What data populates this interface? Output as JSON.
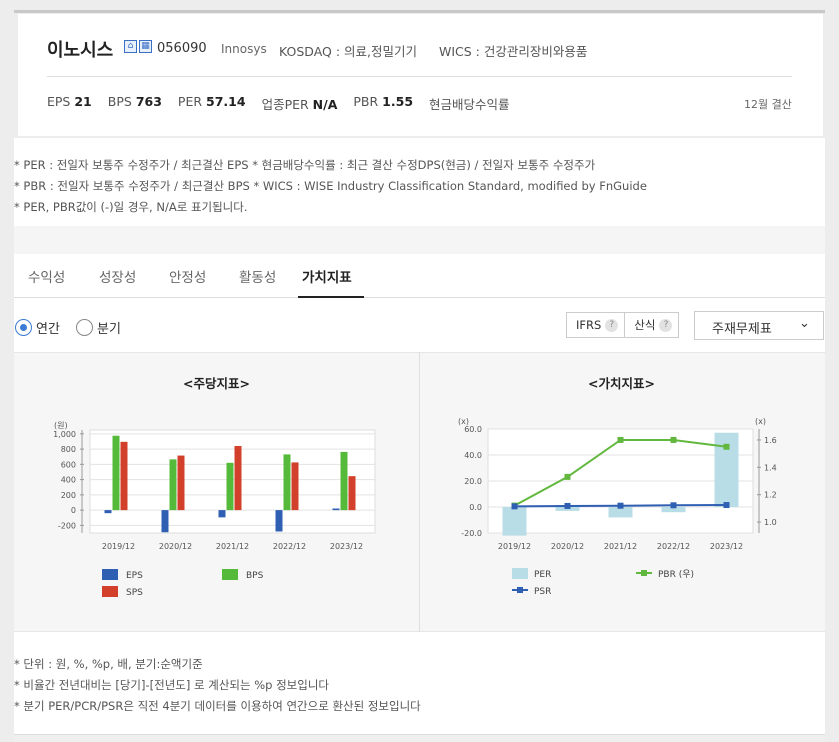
{
  "company": {
    "name": "이노시스",
    "code": "056090",
    "english_name": "Innosys",
    "market": "KOSDAQ : 의료,정밀기기",
    "wics": "WICS : 건강관리장비와용품",
    "settlement": "12월 결산"
  },
  "metrics": [
    {
      "label": "EPS",
      "value": "21"
    },
    {
      "label": "BPS",
      "value": "763"
    },
    {
      "label": "PER",
      "value": "57.14"
    },
    {
      "label": "업종PER",
      "value": "N/A"
    },
    {
      "label": "PBR",
      "value": "1.55"
    },
    {
      "label": "현금배당수익률",
      "value": ""
    }
  ],
  "notes": [
    "* PER : 전일자 보통주 수정주가 / 최근결산 EPS * 현금배당수익률 : 최근 결산 수정DPS(현금) / 전일자 보통주 수정주가",
    "* PBR : 전일자 보통주 수정주가 / 최근결산 BPS * WICS : WISE Industry Classification Standard, modified by FnGuide",
    "* PER, PBR값이 (-)일 경우, N/A로 표기됩니다."
  ],
  "tabs": [
    "수익성",
    "성장성",
    "안정성",
    "활동성",
    "가치지표"
  ],
  "active_tab": "가치지표",
  "period": {
    "annual": "연간",
    "quarter": "분기",
    "selected": "연간"
  },
  "buttons": {
    "ifrs": "IFRS",
    "calc": "산식"
  },
  "select": {
    "value": "주재무제표"
  },
  "charts": {
    "per_share_title": "<주당지표>",
    "valuation_title": "<가치지표>"
  },
  "colors": {
    "eps": "#2f5fb3",
    "bps": "#55b93a",
    "sps": "#d2402b",
    "per": "#b9dde7",
    "pbr": "#62b83e",
    "psr": "#2f5fb3",
    "accent": "#3a7bd5"
  },
  "chart_data": [
    {
      "type": "bar",
      "title": "<주당지표>",
      "ylabel": "(원)",
      "ylim": [
        -300,
        1050
      ],
      "yticks": [
        "1,000",
        "800",
        "600",
        "400",
        "200",
        "0",
        "-200"
      ],
      "categories": [
        "2019/12",
        "2020/12",
        "2021/12",
        "2022/12",
        "2023/12"
      ],
      "series": [
        {
          "name": "EPS",
          "values": [
            -40,
            -290,
            -95,
            -280,
            21
          ]
        },
        {
          "name": "BPS",
          "values": [
            975,
            665,
            620,
            730,
            763
          ]
        },
        {
          "name": "SPS",
          "values": [
            895,
            715,
            840,
            625,
            445
          ]
        }
      ],
      "legend": "bottom",
      "grid": true
    },
    {
      "type": "bar+line",
      "title": "<가치지표>",
      "ylabel_left": "(x)",
      "ylabel_right": "(x)",
      "ylim_left": [
        -20,
        60
      ],
      "ylim_right": [
        0.92,
        1.68
      ],
      "yticks_left": [
        "60.0",
        "40.0",
        "20.0",
        "0.0",
        "-20.0"
      ],
      "yticks_right": [
        "1.6",
        "1.4",
        "1.2",
        "1.0"
      ],
      "categories": [
        "2019/12",
        "2020/12",
        "2021/12",
        "2022/12",
        "2023/12"
      ],
      "series": [
        {
          "name": "PER",
          "axis": "left",
          "kind": "bar",
          "values": [
            -22,
            -3,
            -8,
            -4,
            57.14
          ]
        },
        {
          "name": "PBR (우)",
          "axis": "right",
          "kind": "line",
          "values": [
            1.12,
            1.33,
            1.6,
            1.6,
            1.55
          ]
        },
        {
          "name": "PSR",
          "axis": "left",
          "kind": "line",
          "values": [
            0.5,
            0.8,
            1.0,
            1.3,
            1.5
          ]
        }
      ],
      "legend": "bottom",
      "grid": true
    }
  ],
  "footnotes": [
    "* 단위 : 원, %, %p, 배, 분기:순액기준",
    "* 비율간 전년대비는 [당기]-[전년도] 로 계산되는 %p 정보입니다",
    "* 분기 PER/PCR/PSR은 직전 4분기 데이터를 이용하여 연간으로 환산된 정보입니다"
  ]
}
